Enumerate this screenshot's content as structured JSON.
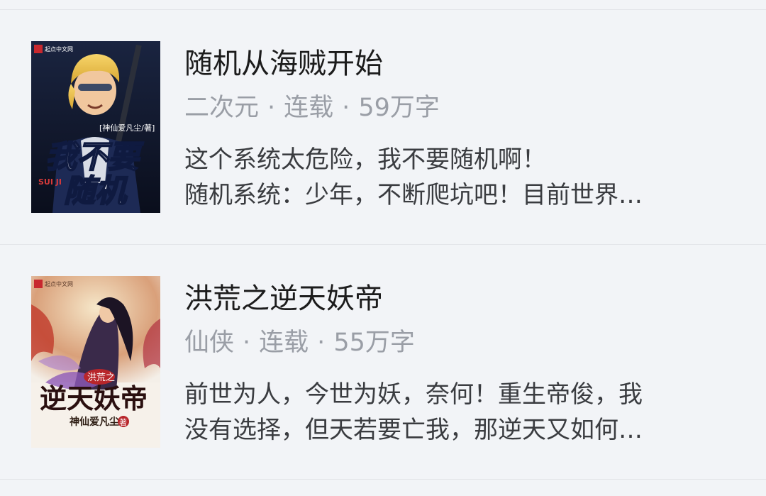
{
  "books": [
    {
      "title": "随机从海贼开始",
      "category": "二次元",
      "status": "连载",
      "word_count": "59万字",
      "desc_line1": "这个系统太危险，我不要随机啊！",
      "desc_line2": "随机系统：少年，不断爬坑吧！目前世界…",
      "cover": {
        "publisher": "起点中文网",
        "author_tag": "[神仙爱凡尘/著]",
        "title_top": "我不要",
        "title_bottom": "随机",
        "pinyin": "SUI JI"
      }
    },
    {
      "title": "洪荒之逆天妖帝",
      "category": "仙侠",
      "status": "连载",
      "word_count": "55万字",
      "desc_line1": "前世为人，今世为妖，奈何！重生帝俊，我",
      "desc_line2": "没有选择，但天若要亡我，那逆天又如何…",
      "cover": {
        "publisher": "起点中文网",
        "title_small": "洪荒之",
        "title_big": "逆天妖帝",
        "author": "神仙爱凡尘",
        "author_mark": "著"
      }
    }
  ],
  "separator": "·"
}
